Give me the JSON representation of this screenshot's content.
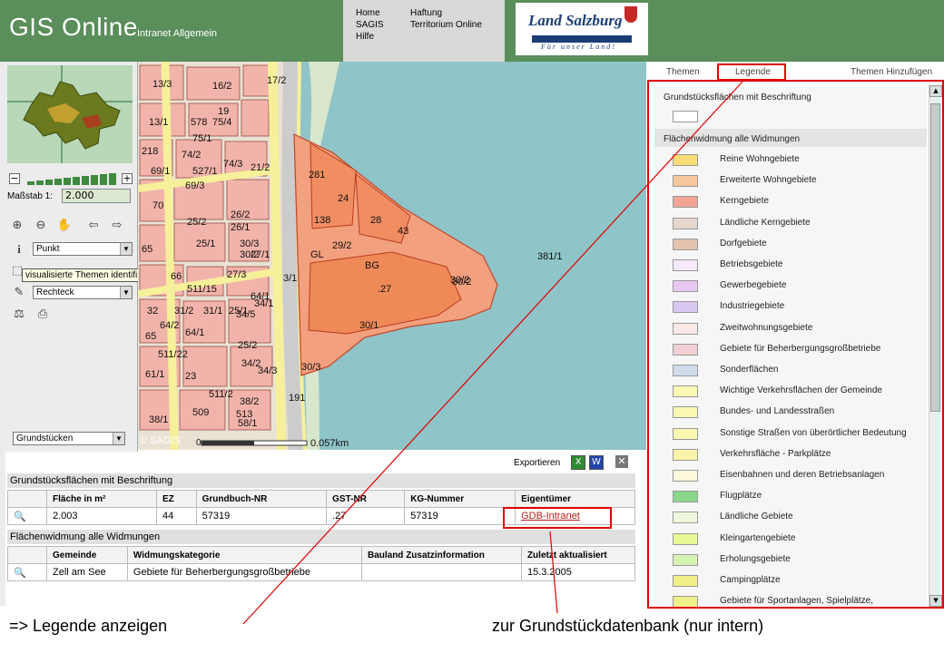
{
  "header": {
    "title": "GIS Online",
    "subtitle": "Intranet Allgemein",
    "nav_col1": [
      "Home",
      "SAGIS",
      "Hilfe"
    ],
    "nav_col2": [
      "Haftung",
      "Territorium Online"
    ],
    "brand_name": "Land Salzburg",
    "brand_tagline": "Für unser Land!"
  },
  "left": {
    "scale_label": "Maßstab  1:",
    "scale_value": "2.000",
    "zoom_minus": "−",
    "zoom_plus": "+",
    "identify_select": "Punkt",
    "tooltip": "visualisierte Themen identifizieren mit:",
    "select_mode": "Rechteck",
    "layer_select": "Grundstücken"
  },
  "map": {
    "copyright": "© SAGIS",
    "scale_start": "0",
    "scale_end": "0.057km",
    "parcels": [
      "13/3",
      "16/2",
      "17/2",
      "13/1",
      "578",
      "75/4",
      "19",
      "75/1",
      "218",
      "74/2",
      "69/1",
      "527/1",
      "74/3",
      "21/2",
      "69/3",
      "281",
      "24",
      "70",
      "138",
      "28",
      "25/2",
      "26/2",
      "26/1",
      "43",
      "29/2",
      "65",
      "25/1",
      "30/3",
      "27/1",
      "30/2",
      "27/3",
      "381/1",
      "66",
      "30/2",
      "GL",
      "BG",
      "3/1",
      "511/15",
      ".27",
      "30/2",
      "64/1",
      "34/1",
      "32",
      "31/2",
      "31/1",
      "25/1",
      "64/2",
      "34/5",
      "30/1",
      "65",
      "64/1",
      "511/22",
      "25/2",
      "34/2",
      "30/3",
      "61/1",
      "23",
      "34/3",
      "511/2",
      "191",
      "38/2",
      "509",
      "513",
      "58/1",
      "38/1"
    ]
  },
  "results": {
    "export_label": "Exportieren",
    "section1_title": "Grundstücksflächen mit Beschriftung",
    "table1_headers": [
      "Fläche in m²",
      "EZ",
      "Grundbuch-NR",
      "GST-NR",
      "KG-Nummer",
      "Eigentümer"
    ],
    "table1_rows": [
      [
        "2.003",
        "44",
        "57319",
        ".27",
        "57319",
        "GDB-Intranet"
      ]
    ],
    "section2_title": "Flächenwidmung alle Widmungen",
    "table2_headers": [
      "Gemeinde",
      "Widmungskategorie",
      "Bauland Zusatzinformation",
      "Zuletzt aktualisiert"
    ],
    "table2_rows": [
      [
        "Zell am See",
        "Gebiete für Beherbergungsgroßbetriebe",
        "",
        "15.3.2005"
      ]
    ]
  },
  "legend": {
    "tabs": [
      "Themen",
      "Legende",
      "Themen Hinzufügen"
    ],
    "group1_title": "Grundstücksflächen mit Beschriftung",
    "group2_title": "Flächenwidmung alle Widmungen",
    "items": [
      {
        "label": "Reine Wohngebiete",
        "color": "#f9dc78"
      },
      {
        "label": "Erweiterte Wohngebiete",
        "color": "#f8c79c"
      },
      {
        "label": "Kerngebiete",
        "color": "#f2a496"
      },
      {
        "label": "Ländliche Kerngebiete",
        "color": "#e6d6cc"
      },
      {
        "label": "Dorfgebiete",
        "color": "#e4c4b0"
      },
      {
        "label": "Betriebsgebiete",
        "color": "#f4e8fa"
      },
      {
        "label": "Gewerbegebiete",
        "color": "#e8c8f2"
      },
      {
        "label": "Industriegebiete",
        "color": "#d8c8f2"
      },
      {
        "label": "Zweitwohnungsgebiete",
        "color": "#fbe8e8"
      },
      {
        "label": "Gebiete für Beherbergungsgroßbetriebe",
        "color": "#f0d0d4"
      },
      {
        "label": "Sonderflächen",
        "color": "#d0dcec"
      },
      {
        "label": "Wichtige Verkehrsflächen der Gemeinde",
        "color": "#fbf8b4"
      },
      {
        "label": "Bundes- und Landesstraßen",
        "color": "#fbf8b4"
      },
      {
        "label": "Sonstige Straßen von überörtlicher Bedeutung",
        "color": "#fbf8b4"
      },
      {
        "label": "Verkehrsfläche - Parkplätze",
        "color": "#fbf4a8"
      },
      {
        "label": "Eisenbahnen und deren Betriebsanlagen",
        "color": "#fbf8dc"
      },
      {
        "label": "Flugplätze",
        "color": "#8ad88a"
      },
      {
        "label": "Ländliche Gebiete",
        "color": "#f0f8dc"
      },
      {
        "label": "Kleingartengebiete",
        "color": "#e8f894"
      },
      {
        "label": "Erholungsgebiete",
        "color": "#d8f4b4"
      },
      {
        "label": "Campingplätze",
        "color": "#f0f088"
      },
      {
        "label": "Gebiete für Sportanlagen, Spielplätze,",
        "color": "#f0f088"
      }
    ]
  },
  "captions": {
    "left": "=> Legende anzeigen",
    "right": "zur Grundstückdatenbank (nur intern)"
  },
  "colors": {
    "header_green": "#5a8e5a",
    "highlight_red": "#e00000",
    "water": "#8fc4c8",
    "parcel_pink": "#f2b4aa",
    "parcel_orange": "#f08a5c"
  }
}
